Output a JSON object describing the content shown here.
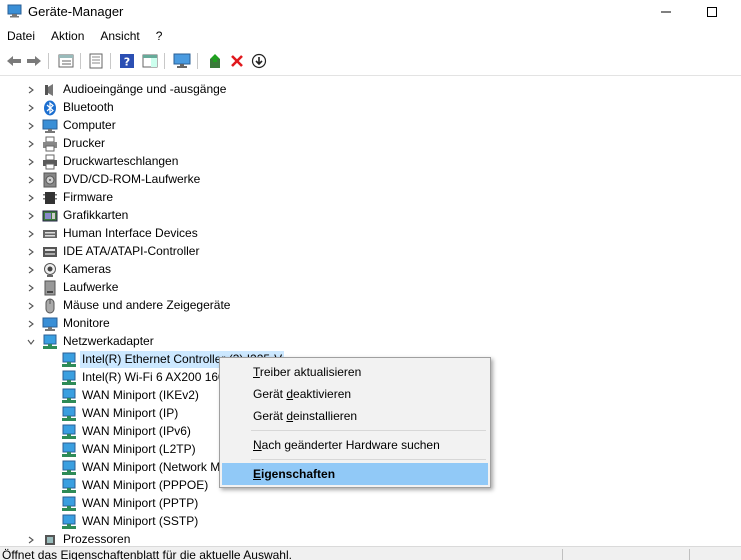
{
  "window": {
    "title": "Geräte-Manager"
  },
  "menu": [
    "Datei",
    "Aktion",
    "Ansicht",
    "?"
  ],
  "toolbar": [
    {
      "name": "back-arrow-icon"
    },
    {
      "name": "forward-arrow-icon"
    },
    {
      "name": "tree-view-icon"
    },
    {
      "name": "properties-sheet-icon"
    },
    {
      "name": "help-icon"
    },
    {
      "name": "action-pane-icon"
    },
    {
      "name": "monitor-scan-icon"
    },
    {
      "name": "update-driver-icon"
    },
    {
      "name": "uninstall-x-icon"
    },
    {
      "name": "disable-device-icon"
    }
  ],
  "tree": {
    "categories": [
      {
        "label": "Audioeingänge und -ausgänge",
        "icon": "audio-icon"
      },
      {
        "label": "Bluetooth",
        "icon": "bluetooth-icon"
      },
      {
        "label": "Computer",
        "icon": "computer-icon"
      },
      {
        "label": "Drucker",
        "icon": "printer-icon"
      },
      {
        "label": "Druckwarteschlangen",
        "icon": "print-queue-icon"
      },
      {
        "label": "DVD/CD-ROM-Laufwerke",
        "icon": "dvd-icon"
      },
      {
        "label": "Firmware",
        "icon": "firmware-icon"
      },
      {
        "label": "Grafikkarten",
        "icon": "graphics-card-icon"
      },
      {
        "label": "Human Interface Devices",
        "icon": "hid-icon"
      },
      {
        "label": "IDE ATA/ATAPI-Controller",
        "icon": "ide-icon"
      },
      {
        "label": "Kameras",
        "icon": "camera-icon"
      },
      {
        "label": "Laufwerke",
        "icon": "drive-icon"
      },
      {
        "label": "Mäuse und andere Zeigegeräte",
        "icon": "mouse-icon"
      },
      {
        "label": "Monitore",
        "icon": "monitor-icon"
      },
      {
        "label": "Netzwerkadapter",
        "icon": "network-icon",
        "expanded": true
      }
    ],
    "network_adapters": [
      {
        "label": "Intel(R) Ethernet Controller (3) I225-V",
        "selected": true
      },
      {
        "label": "Intel(R) Wi-Fi 6 AX200 160MHz"
      },
      {
        "label": "WAN Miniport (IKEv2)"
      },
      {
        "label": "WAN Miniport (IP)"
      },
      {
        "label": "WAN Miniport (IPv6)"
      },
      {
        "label": "WAN Miniport (L2TP)"
      },
      {
        "label": "WAN Miniport (Network Monitor)"
      },
      {
        "label": "WAN Miniport (PPPOE)"
      },
      {
        "label": "WAN Miniport (PPTP)"
      },
      {
        "label": "WAN Miniport (SSTP)"
      }
    ],
    "after": [
      {
        "label": "Prozessoren",
        "icon": "processor-icon"
      }
    ]
  },
  "context_menu": {
    "items": [
      {
        "label": "Treiber aktualisieren",
        "underline_index": 0
      },
      {
        "label": "Gerät deaktivieren",
        "underline_index": 6
      },
      {
        "label": "Gerät deinstallieren",
        "underline_index": 6
      },
      {
        "label": "Nach geänderter Hardware suchen",
        "underline_index": 0,
        "separator_before": true
      },
      {
        "label": "Eigenschaften",
        "underline_index": 0,
        "separator_before": true,
        "highlight": true
      }
    ]
  },
  "status": {
    "text": "Öffnet das Eigenschaftenblatt für die aktuelle Auswahl."
  },
  "colors": {
    "selection": "#cce8ff",
    "menu_highlight": "#91c9f7",
    "delete_red": "#e0191e"
  }
}
